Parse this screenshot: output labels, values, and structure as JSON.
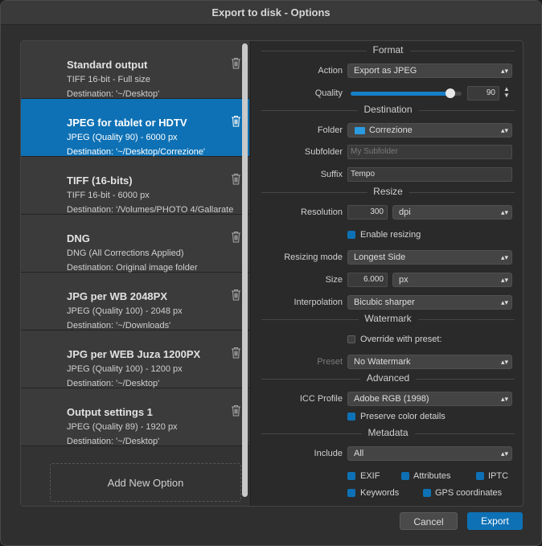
{
  "window": {
    "title": "Export to disk - Options"
  },
  "presets": [
    {
      "name": "Standard output",
      "line1": "TIFF 16-bit - Full size",
      "line2": "Destination: '~/Desktop'"
    },
    {
      "name": "JPEG for tablet or HDTV",
      "line1": "JPEG (Quality 90) - 6000 px",
      "line2": "Destination: '~/Desktop/Correzione'"
    },
    {
      "name": "TIFF (16-bits)",
      "line1": "TIFF 16-bit - 6000 px",
      "line2": "Destination: '/Volumes/PHOTO 4/Gallarate"
    },
    {
      "name": "DNG",
      "line1": "DNG (All Corrections Applied)",
      "line2": "Destination: Original image folder"
    },
    {
      "name": "JPG per WB 2048PX",
      "line1": "JPEG (Quality 100) - 2048 px",
      "line2": "Destination: '~/Downloads'"
    },
    {
      "name": "JPG per WEB Juza 1200PX",
      "line1": "JPEG (Quality 100) - 1200 px",
      "line2": "Destination: '~/Desktop'"
    },
    {
      "name": "Output settings 1",
      "line1": "JPEG (Quality 89) - 1920 px",
      "line2": "Destination: '~/Desktop'"
    }
  ],
  "add_option_label": "Add New Option",
  "sections": {
    "format": "Format",
    "destination": "Destination",
    "resize": "Resize",
    "watermark": "Watermark",
    "advanced": "Advanced",
    "metadata": "Metadata"
  },
  "format": {
    "action_label": "Action",
    "action_value": "Export as JPEG",
    "quality_label": "Quality",
    "quality_value": "90",
    "quality_level": 0.9
  },
  "destination": {
    "folder_label": "Folder",
    "folder_value": "Correzione",
    "subfolder_label": "Subfolder",
    "subfolder_placeholder": "My Subfolder",
    "suffix_label": "Suffix",
    "suffix_value": "Tempo"
  },
  "resize": {
    "resolution_label": "Resolution",
    "resolution_value": "300",
    "resolution_unit": "dpi",
    "enable_resizing": "Enable resizing",
    "mode_label": "Resizing mode",
    "mode_value": "Longest Side",
    "size_label": "Size",
    "size_value": "6.000",
    "size_unit": "px",
    "interp_label": "Interpolation",
    "interp_value": "Bicubic sharper"
  },
  "watermark": {
    "override_label": "Override with preset:",
    "preset_label": "Preset",
    "preset_value": "No Watermark"
  },
  "advanced": {
    "icc_label": "ICC Profile",
    "icc_value": "Adobe RGB (1998)",
    "preserve_label": "Preserve color details"
  },
  "metadata": {
    "include_label": "Include",
    "include_value": "All",
    "exif": "EXIF",
    "attributes": "Attributes",
    "iptc": "IPTC",
    "keywords": "Keywords",
    "gps": "GPS coordinates"
  },
  "buttons": {
    "cancel": "Cancel",
    "export": "Export"
  },
  "colors": {
    "accent": "#0e71b5",
    "folder_icon": "#2a9be0"
  }
}
